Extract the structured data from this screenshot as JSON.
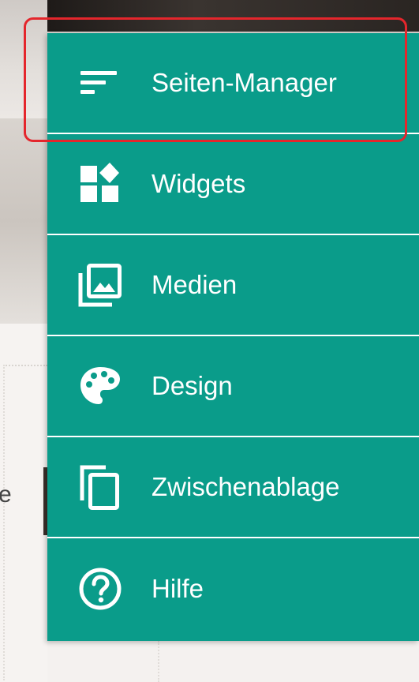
{
  "menu": {
    "items": [
      {
        "label": "Seiten-Manager",
        "icon": "sort-lines-icon"
      },
      {
        "label": "Widgets",
        "icon": "widgets-icon"
      },
      {
        "label": "Medien",
        "icon": "photo-library-icon"
      },
      {
        "label": "Design",
        "icon": "palette-icon"
      },
      {
        "label": "Zwischenablage",
        "icon": "copy-icon"
      },
      {
        "label": "Hilfe",
        "icon": "help-circle-icon"
      }
    ],
    "accent_color": "#0a9c8a",
    "highlight_color": "#e4262c"
  },
  "background": {
    "partial_text": "e"
  }
}
